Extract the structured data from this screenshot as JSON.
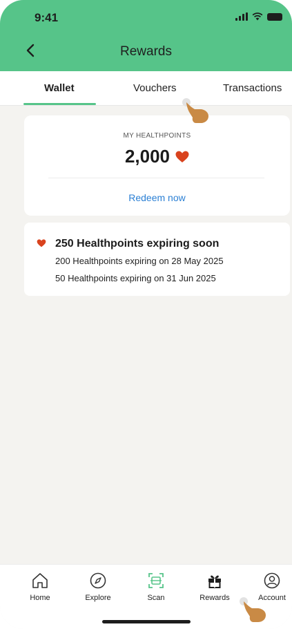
{
  "status_bar": {
    "time": "9:41"
  },
  "header": {
    "title": "Rewards"
  },
  "tabs": [
    {
      "label": "Wallet",
      "active": true
    },
    {
      "label": "Vouchers",
      "active": false
    },
    {
      "label": "Transactions",
      "active": false
    }
  ],
  "points_card": {
    "label": "MY HEALTHPOINTS",
    "value": "2,000",
    "action": "Redeem now"
  },
  "expiry_card": {
    "title": "250 Healthpoints expiring soon",
    "lines": [
      "200 Healthpoints expiring on 28 May 2025",
      "50 Healthpoints expiring on 31 Jun 2025"
    ]
  },
  "bottom_nav": [
    {
      "label": "Home",
      "icon": "home-icon"
    },
    {
      "label": "Explore",
      "icon": "compass-icon"
    },
    {
      "label": "Scan",
      "icon": "scan-icon"
    },
    {
      "label": "Rewards",
      "icon": "gift-icon"
    },
    {
      "label": "Account",
      "icon": "account-icon"
    }
  ],
  "colors": {
    "brand_green": "#56c489",
    "heart_red": "#d9431e",
    "link_blue": "#2a7fd4",
    "background": "#f4f3f0"
  }
}
